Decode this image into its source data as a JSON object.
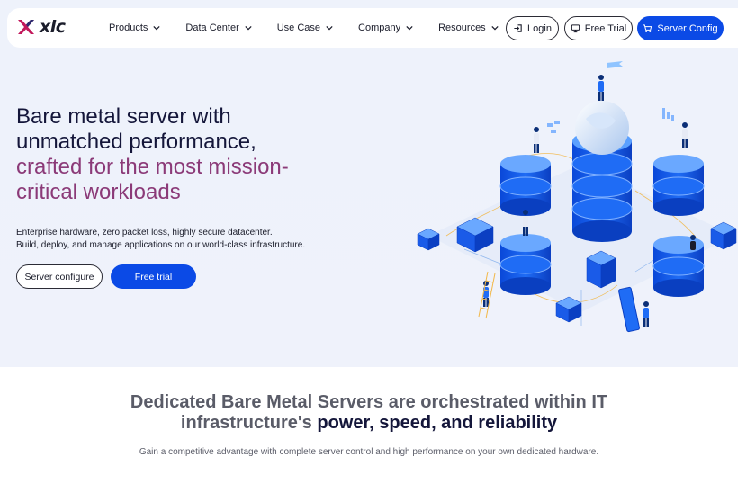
{
  "brand": {
    "name": "xlc",
    "accent": "#8b3a78",
    "primary": "#0b4ae6"
  },
  "nav": {
    "menu": [
      {
        "label": "Products"
      },
      {
        "label": "Data Center"
      },
      {
        "label": "Use Case"
      },
      {
        "label": "Company"
      },
      {
        "label": "Resources"
      }
    ],
    "login_label": "Login",
    "free_trial_label": "Free Trial",
    "server_config_label": "Server Config"
  },
  "hero": {
    "title_line1": "Bare metal server with",
    "title_line2": "unmatched performance,",
    "title_accent1": "crafted for the most mission-",
    "title_accent2": "critical workloads",
    "subtitle1": "Enterprise hardware, zero packet loss, highly secure datacenter.",
    "subtitle2": "Build, deploy, and manage applications on our world-class infrastructure.",
    "cta_configure": "Server configure",
    "cta_trial": "Free trial"
  },
  "section": {
    "heading_part1": "Dedicated Bare Metal Servers are orchestrated within IT",
    "heading_part2": "infrastructure's ",
    "heading_strong": "power, speed, and reliability",
    "text": "Gain a competitive advantage with complete server control and high performance on your own dedicated hardware."
  }
}
